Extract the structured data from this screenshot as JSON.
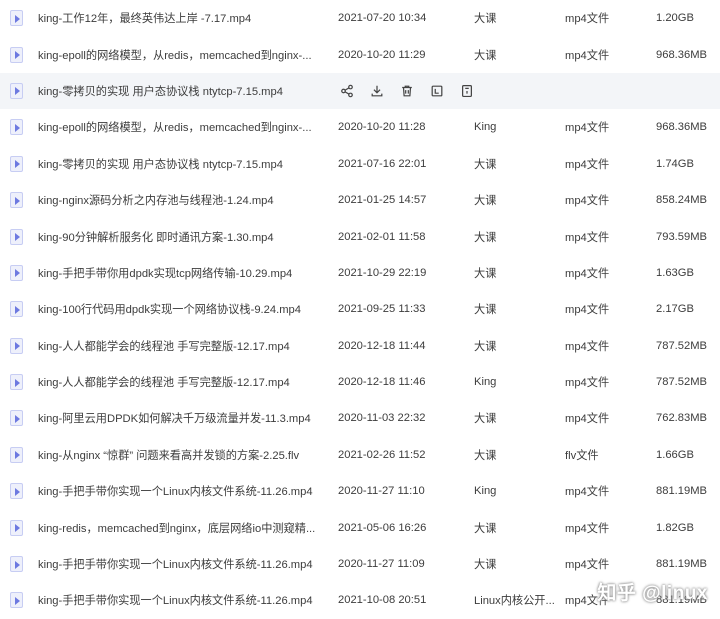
{
  "files": [
    {
      "name": "king-工作12年，最终英伟达上岸 -7.17.mp4",
      "date": "2021-07-20 10:34",
      "owner": "大课",
      "type": "mp4文件",
      "size": "1.20GB"
    },
    {
      "name": "king-epoll的网络模型，从redis，memcached到nginx-...",
      "date": "2020-10-20 11:29",
      "owner": "大课",
      "type": "mp4文件",
      "size": "968.36MB"
    },
    {
      "name": "king-零拷贝的实现 用户态协议栈 ntytcp-7.15.mp4",
      "date": "",
      "owner": "",
      "type": "",
      "size": ""
    },
    {
      "name": "king-epoll的网络模型，从redis，memcached到nginx-...",
      "date": "2020-10-20 11:28",
      "owner": "King",
      "type": "mp4文件",
      "size": "968.36MB"
    },
    {
      "name": "king-零拷贝的实现 用户态协议栈 ntytcp-7.15.mp4",
      "date": "2021-07-16 22:01",
      "owner": "大课",
      "type": "mp4文件",
      "size": "1.74GB"
    },
    {
      "name": "king-nginx源码分析之内存池与线程池-1.24.mp4",
      "date": "2021-01-25 14:57",
      "owner": "大课",
      "type": "mp4文件",
      "size": "858.24MB"
    },
    {
      "name": "king-90分钟解析服务化 即时通讯方案-1.30.mp4",
      "date": "2021-02-01 11:58",
      "owner": "大课",
      "type": "mp4文件",
      "size": "793.59MB"
    },
    {
      "name": "king-手把手带你用dpdk实现tcp网络传输-10.29.mp4",
      "date": "2021-10-29 22:19",
      "owner": "大课",
      "type": "mp4文件",
      "size": "1.63GB"
    },
    {
      "name": "king-100行代码用dpdk实现一个网络协议栈-9.24.mp4",
      "date": "2021-09-25 11:33",
      "owner": "大课",
      "type": "mp4文件",
      "size": "2.17GB"
    },
    {
      "name": "king-人人都能学会的线程池 手写完整版-12.17.mp4",
      "date": "2020-12-18 11:44",
      "owner": "大课",
      "type": "mp4文件",
      "size": "787.52MB"
    },
    {
      "name": "king-人人都能学会的线程池 手写完整版-12.17.mp4",
      "date": "2020-12-18 11:46",
      "owner": "King",
      "type": "mp4文件",
      "size": "787.52MB"
    },
    {
      "name": "king-阿里云用DPDK如何解决千万级流量并发-11.3.mp4",
      "date": "2020-11-03 22:32",
      "owner": "大课",
      "type": "mp4文件",
      "size": "762.83MB"
    },
    {
      "name": "king-从nginx “惊群” 问题来看高并发锁的方案-2.25.flv",
      "date": "2021-02-26 11:52",
      "owner": "大课",
      "type": "flv文件",
      "size": "1.66GB"
    },
    {
      "name": "king-手把手带你实现一个Linux内核文件系统-11.26.mp4",
      "date": "2020-11-27 11:10",
      "owner": "King",
      "type": "mp4文件",
      "size": "881.19MB"
    },
    {
      "name": "king-redis，memcached到nginx，底层网络io中测窥精...",
      "date": "2021-05-06 16:26",
      "owner": "大课",
      "type": "mp4文件",
      "size": "1.82GB"
    },
    {
      "name": "king-手把手带你实现一个Linux内核文件系统-11.26.mp4",
      "date": "2020-11-27 11:09",
      "owner": "大课",
      "type": "mp4文件",
      "size": "881.19MB"
    },
    {
      "name": "king-手把手带你实现一个Linux内核文件系统-11.26.mp4",
      "date": "2021-10-08 20:51",
      "owner": "Linux内核公开...",
      "type": "mp4文件",
      "size": "881.19MB"
    }
  ],
  "hover_row_index": 2,
  "hover_actions": [
    {
      "icon": "share-icon"
    },
    {
      "icon": "download-icon"
    },
    {
      "icon": "delete-icon"
    },
    {
      "icon": "open-icon"
    },
    {
      "icon": "info-icon"
    }
  ],
  "watermark": "知乎 @linux",
  "colors": {
    "hover_bg": "#f3f5f8",
    "file_icon": "#6d79e0",
    "text": "#3c3c3c"
  }
}
